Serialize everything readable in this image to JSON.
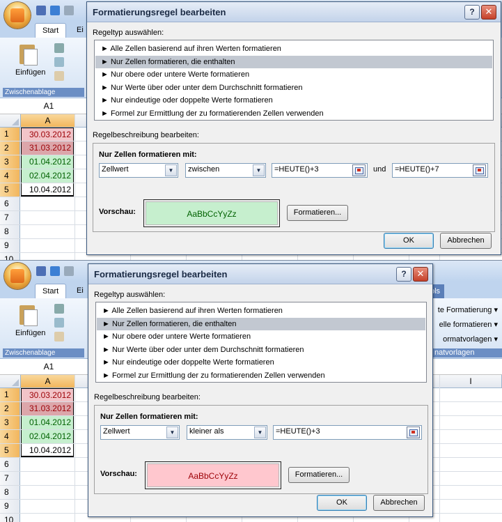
{
  "excel": {
    "tabs": {
      "start": "Start",
      "next_partial": "Ei"
    },
    "paste_label": "Einfügen",
    "clipboard_group": "Zwischenablage",
    "name_box": "A1",
    "column_a": "A",
    "column_i": "I",
    "rows": [
      {
        "num": "1",
        "value": "30.03.2012",
        "bg": "#f2c4c8",
        "fg": "#9c0006"
      },
      {
        "num": "2",
        "value": "31.03.2012",
        "bg": "#dca6aa",
        "fg": "#9c0006"
      },
      {
        "num": "3",
        "value": "01.04.2012",
        "bg": "#c6efce",
        "fg": "#006100"
      },
      {
        "num": "4",
        "value": "02.04.2012",
        "bg": "#c6efce",
        "fg": "#006100"
      },
      {
        "num": "5",
        "value": "10.04.2012",
        "bg": "#ffffff",
        "fg": "#000000"
      }
    ],
    "empty_rows": [
      "6",
      "7",
      "8",
      "9",
      "10"
    ],
    "ribbon_right": {
      "tools_partial": "ols",
      "cond_format_partial": "te Formatierung",
      "cell_format_partial": "elle formatieren",
      "styles_partial": "ormatvorlagen",
      "styles_group_partial": "natvorlagen"
    }
  },
  "dialog": {
    "title": "Formatierungsregel bearbeiten",
    "help": "?",
    "close": "✕",
    "ruletype_label": "Regeltyp auswählen:",
    "ruletypes": [
      "► Alle Zellen basierend auf ihren Werten formatieren",
      "► Nur Zellen formatieren, die enthalten",
      "► Nur obere oder untere Werte formatieren",
      "► Nur Werte über oder unter dem Durchschnitt formatieren",
      "► Nur eindeutige oder doppelte Werte formatieren",
      "► Formel zur Ermittlung der zu formatierenden Zellen verwenden"
    ],
    "selected_ruletype_index": 1,
    "desc_label": "Regelbeschreibung bearbeiten:",
    "desc_head": "Nur Zellen formatieren mit:",
    "preview_label": "Vorschau:",
    "preview_sample": "AaBbCcYyZz",
    "format_button": "Formatieren...",
    "ok": "OK",
    "cancel": "Abbrechen",
    "and_label": "und"
  },
  "rule_top": {
    "field": "Zellwert",
    "operator": "zwischen",
    "value1": "=HEUTE()+3",
    "value2": "=HEUTE()+7",
    "preview_bg": "#c6efce",
    "preview_fg": "#006100"
  },
  "rule_bottom": {
    "field": "Zellwert",
    "operator": "kleiner als",
    "value1": "=HEUTE()+3",
    "preview_bg": "#ffc7ce",
    "preview_fg": "#9c0006"
  }
}
